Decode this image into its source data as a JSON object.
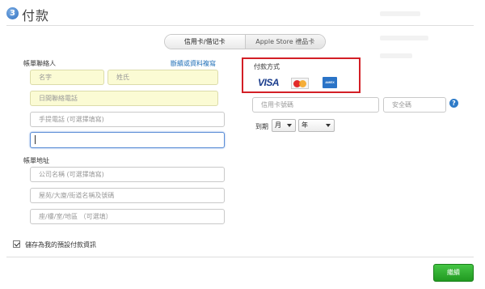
{
  "header": {
    "step_number": "3",
    "title": "付款"
  },
  "tabs": [
    {
      "label": "信用卡/借记卡",
      "active": true
    },
    {
      "label": "Apple Store 禮品卡",
      "active": false
    }
  ],
  "billing_contact": {
    "section_label": "帳單聯絡人",
    "edit_link": "斷續或資料複寫",
    "first_name_placeholder": "名字",
    "last_name_placeholder": "姓氏",
    "day_phone_placeholder": "日間聯絡電話",
    "mobile_placeholder": "手提電話 (可選擇填寫)",
    "email_value": ""
  },
  "billing_address": {
    "section_label": "帳單地址",
    "company_placeholder": "公司名稱 (可選擇填寫)",
    "building_placeholder": "屋苑/大廈/街道名稱及號碼",
    "floor_placeholder": "座/樓/室/地區 （可選填）"
  },
  "payment": {
    "method_label": "付款方式",
    "card_brands": [
      "VISA",
      "mastercard",
      "AMEX"
    ],
    "card_number_placeholder": "信用卡號碼",
    "security_code_placeholder": "安全碼",
    "help_icon": "?",
    "expiry_label": "到期",
    "month_select": "月",
    "year_select": "年"
  },
  "footer": {
    "save_default_label": "儲存為我的預設付款資訊",
    "save_default_checked": true,
    "continue_label": "繼續"
  },
  "colors": {
    "accent_link": "#1f6fb7",
    "highlight_border": "#d31f26",
    "continue_button": "#2aa52a",
    "autofill_field": "#fbfbd4"
  }
}
